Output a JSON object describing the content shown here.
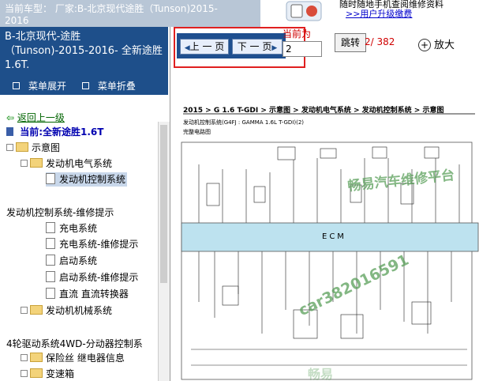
{
  "header": {
    "vehicle_line1": "当前车型： 厂家:B-北京现代途胜（Tunson)2015-",
    "vehicle_line2": "2016",
    "upgrade_text": "随时随地手机查阅维修资料",
    "upgrade_link": ">>用户升级缴费"
  },
  "sidebar": {
    "title": "B-北京现代-途胜（Tunson)-2015-2016- 全新途胜1.6T.",
    "expand_label": "菜单展开",
    "collapse_label": "菜单折叠",
    "back_label": "返回上一级",
    "current_label": "当前:全新途胜1.6T",
    "tree": [
      {
        "label": "示意图",
        "type": "folder"
      },
      {
        "label": "发动机电气系统",
        "type": "folder"
      },
      {
        "label": "发动机控制系统",
        "type": "doc",
        "selected": true
      },
      {
        "label": "发动机控制系统-维修提示",
        "type": "text"
      },
      {
        "label": "充电系统",
        "type": "doc"
      },
      {
        "label": "充电系统-维修提示",
        "type": "doc"
      },
      {
        "label": "启动系统",
        "type": "doc"
      },
      {
        "label": "启动系统-维修提示",
        "type": "doc"
      },
      {
        "label": "直流 直流转换器",
        "type": "doc"
      },
      {
        "label": "发动机机械系统",
        "type": "folder"
      },
      {
        "label": "4轮驱动系统4WD-分动器控制系",
        "type": "text"
      },
      {
        "label": "保险丝 继电器信息",
        "type": "folder"
      },
      {
        "label": "变速箱",
        "type": "folder"
      }
    ]
  },
  "toolbar": {
    "prev_label": "上 一 页",
    "next_label": "下 一 页",
    "current_page_label": "当前为",
    "current_page_value": "2",
    "jump_label": "跳转",
    "page_count": "2/ 382",
    "zoom_in_label": "放大"
  },
  "diagram": {
    "breadcrumb": "2015 > G 1.6 T-GDI > 示意图 > 发动机电气系统 > 发动机控制系统 > 示意图",
    "subtitle": "发动机控制系统(G4FJ : GAMMA 1.6L T-GDI)(2)",
    "section": "完整电路图",
    "ecm_label": "ECM",
    "watermark1": "畅易汽车维修平台",
    "watermark2": "car382016591",
    "watermark3": "畅易"
  }
}
